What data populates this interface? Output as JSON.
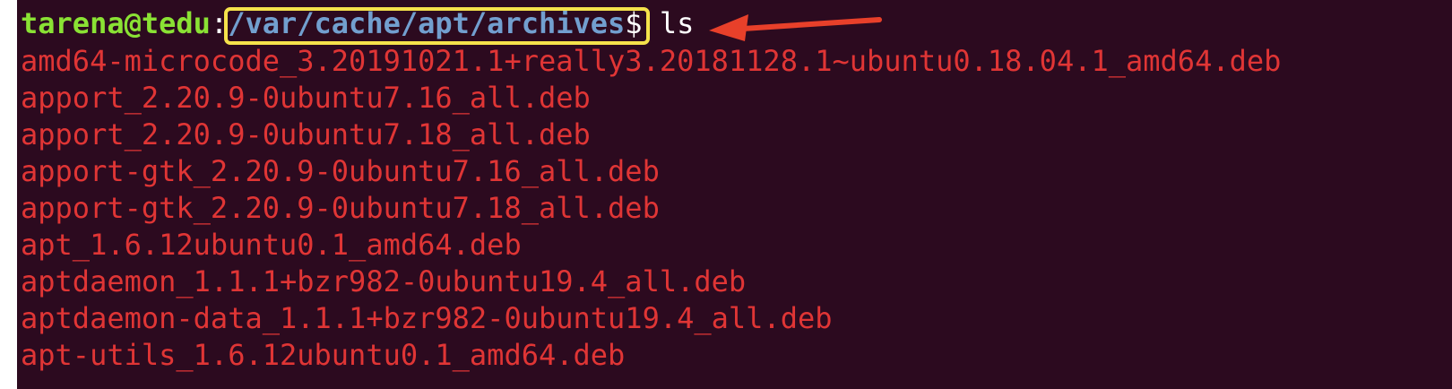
{
  "terminal": {
    "prompt": {
      "user_host": "tarena@tedu",
      "separator": ":",
      "cwd": "/var/cache/apt/archives",
      "symbol": "$",
      "command": " ls"
    },
    "files": [
      "amd64-microcode_3.20191021.1+really3.20181128.1~ubuntu0.18.04.1_amd64.deb",
      "apport_2.20.9-0ubuntu7.16_all.deb",
      "apport_2.20.9-0ubuntu7.18_all.deb",
      "apport-gtk_2.20.9-0ubuntu7.16_all.deb",
      "apport-gtk_2.20.9-0ubuntu7.18_all.deb",
      "apt_1.6.12ubuntu0.1_amd64.deb",
      "aptdaemon_1.1.1+bzr982-0ubuntu19.4_all.deb",
      "aptdaemon-data_1.1.1+bzr982-0ubuntu19.4_all.deb",
      "apt-utils_1.6.12ubuntu0.1_amd64.deb"
    ],
    "colors": {
      "background": "#2c0a1f",
      "user_host": "#8ae234",
      "cwd": "#729fcf",
      "text": "#ffffff",
      "file": "#e03535",
      "highlight": "#f5e24b",
      "arrow": "#e8402a"
    }
  },
  "annotations": {
    "highlight_target": "cwd",
    "arrow_target": "command"
  }
}
